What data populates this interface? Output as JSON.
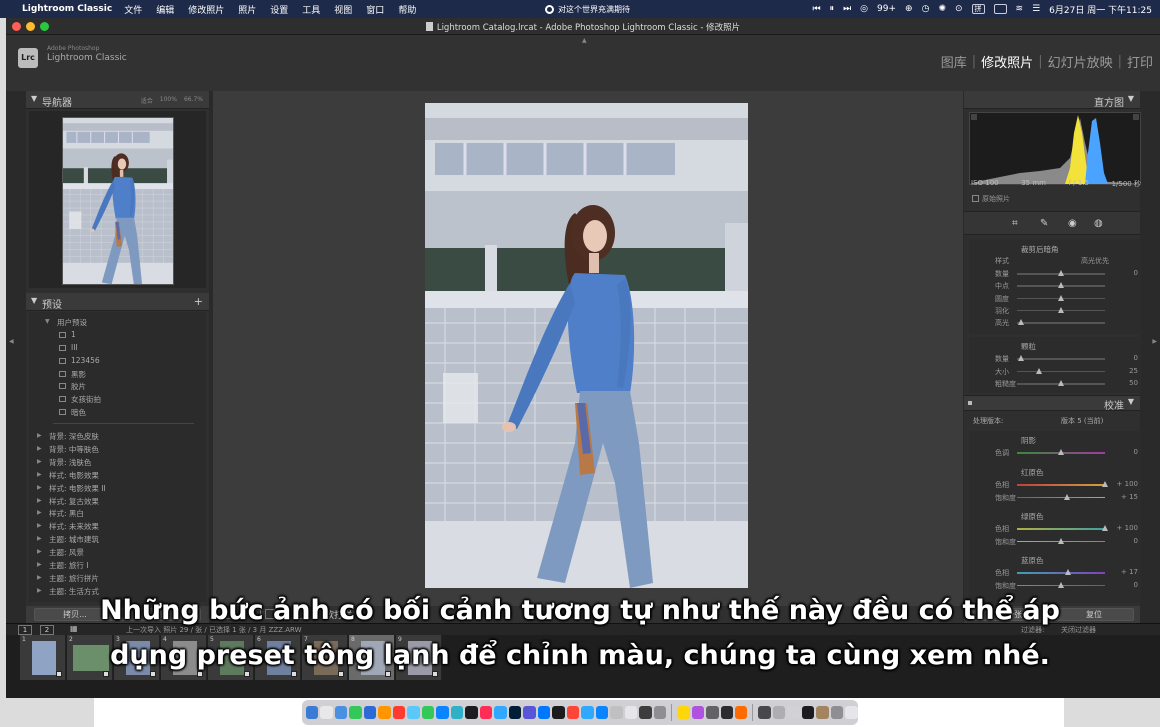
{
  "menubar": {
    "app_name": "Lightroom Classic",
    "items": [
      "文件",
      "编辑",
      "修改照片",
      "照片",
      "设置",
      "工具",
      "视图",
      "窗口",
      "帮助"
    ],
    "center_message": "对这个世界充满期待",
    "badge_count": "99+",
    "datetime": "6月27日 周一 下午11:25"
  },
  "window": {
    "title": "Lightroom Catalog.lrcat - Adobe Photoshop Lightroom Classic - 修改照片"
  },
  "lr_header": {
    "badge": "Lrc",
    "brand_small": "Adobe Photoshop",
    "brand": "Lightroom Classic",
    "modules": [
      "图库",
      "修改照片",
      "幻灯片放映",
      "打印"
    ],
    "active_module": "修改照片"
  },
  "left_panel": {
    "navigator_title": "导航器",
    "navigator_zooms": [
      "适合",
      "100%",
      "66.7%"
    ],
    "presets_title": "预设",
    "presets_plus": "+",
    "user_preset_group": "用户预设",
    "user_presets": [
      "1",
      "III",
      "123456",
      "黑影",
      "胶片",
      "女孩街拍",
      "暗色"
    ],
    "preset_groups": [
      "背景: 深色皮肤",
      "背景: 中等肤色",
      "背景: 浅肤色",
      "样式: 电影效果",
      "样式: 电影效果 II",
      "样式: 复古效果",
      "样式: 黑白",
      "样式: 未来效果",
      "主题: 城市建筑",
      "主题: 风景",
      "主题: 旅行 I",
      "主题: 旅行拼片",
      "主题: 生活方式"
    ],
    "copy_button": "拷贝...",
    "paste_button": "粘贴"
  },
  "toolbar": {
    "soft_proof": "软打样"
  },
  "right_panel": {
    "histogram_title": "直方图",
    "histogram_info": [
      "ISO 100",
      "35 mm",
      "f / 1.5",
      "1/500 秒"
    ],
    "original_photo": "原始照片",
    "vignette_title": "裁剪后暗角",
    "vignette_style_label": "样式",
    "vignette_style_value": "高光优先",
    "vignette_rows": [
      {
        "label": "数量",
        "value": "0",
        "pos": 0.5
      },
      {
        "label": "中点",
        "value": "",
        "pos": 0.5
      },
      {
        "label": "圆度",
        "value": "",
        "pos": 0.5
      },
      {
        "label": "羽化",
        "value": "",
        "pos": 0.5
      },
      {
        "label": "高光",
        "value": "",
        "pos": 0.05
      }
    ],
    "grain_title": "颗粒",
    "grain_rows": [
      {
        "label": "数量",
        "value": "0",
        "pos": 0.05
      },
      {
        "label": "大小",
        "value": "25",
        "pos": 0.25
      },
      {
        "label": "粗糙度",
        "value": "50",
        "pos": 0.5
      }
    ],
    "calibration_title": "校准",
    "process_label": "处理版本:",
    "process_value": "版本 5 (当前)",
    "shadows_title": "阴影",
    "shadows_tint_label": "色调",
    "shadows_tint_value": "0",
    "red_title": "红原色",
    "red_rows": [
      {
        "label": "色相",
        "value": "+ 100",
        "pos": 1.0
      },
      {
        "label": "饱和度",
        "value": "+ 15",
        "pos": 0.57
      }
    ],
    "green_title": "绿原色",
    "green_rows": [
      {
        "label": "色相",
        "value": "+ 100",
        "pos": 1.0
      },
      {
        "label": "饱和度",
        "value": "0",
        "pos": 0.5
      }
    ],
    "blue_title": "蓝原色",
    "blue_rows": [
      {
        "label": "色相",
        "value": "+ 17",
        "pos": 0.58
      },
      {
        "label": "饱和度",
        "value": "0",
        "pos": 0.5
      }
    ],
    "prev_button": "上一张",
    "reset_button": "复位"
  },
  "filmstrip": {
    "pages": [
      "1",
      "2"
    ],
    "path": "上一次导入   照片 29 / 张 / 已选择 1 张 / 3 月 ZZZ.ARW",
    "filter": "过滤器:",
    "filter_value": "关闭过滤器",
    "cells": [
      "1",
      "2",
      "3",
      "4",
      "5",
      "6",
      "7",
      "8",
      "9"
    ]
  },
  "subtitle": {
    "line1": "Những bức ảnh có bối cảnh tương tự như thế này đều có thể áp",
    "line2": "dụng preset tông lạnh để chỉnh màu, chúng ta cùng xem nhé."
  },
  "colors": {
    "menubar_bg": "#1e2a4a",
    "panel_bg": "#2f2f2f",
    "histogram_yellow": "#f2e23a",
    "histogram_blue": "#4aa4ff"
  }
}
